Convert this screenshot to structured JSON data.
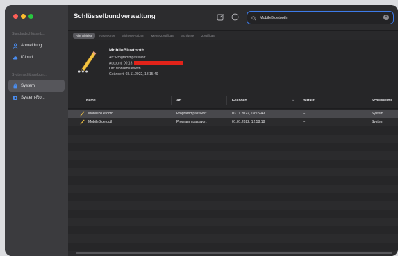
{
  "window": {
    "title": "Schlüsselbundverwaltung"
  },
  "sidebar": {
    "section_default": "Standardschlüsselb...",
    "default_items": [
      {
        "label": "Anmeldung",
        "icon": "person-icon"
      },
      {
        "label": "iCloud",
        "icon": "cloud-icon"
      }
    ],
    "section_system": "Systemschlüsselbun...",
    "system_items": [
      {
        "label": "System",
        "icon": "lock-icon",
        "selected": true
      },
      {
        "label": "System-Ro...",
        "icon": "certificate-icon"
      }
    ]
  },
  "toolbar": {
    "compose_icon": "compose-icon",
    "info_icon": "info-icon"
  },
  "search": {
    "value": "MobileBluetooth",
    "placeholder": "Suchen"
  },
  "filters": [
    {
      "label": "Alle Objekte",
      "active": true
    },
    {
      "label": "Passwörter"
    },
    {
      "label": "Sichere Notizen"
    },
    {
      "label": "Meine Zertifikate"
    },
    {
      "label": "Schlüssel"
    },
    {
      "label": "Zertifikate"
    }
  ],
  "detail": {
    "name": "MobileBluetooth",
    "kind": "Art: Programmpasswort",
    "account_prefix": "Account: 00:18:",
    "location": "Ort: MobileBluetooth",
    "modified": "Geändert: 03.11.2022, 18:15:49"
  },
  "table": {
    "columns": [
      "Name",
      "Art",
      "Geändert",
      "Verfällt",
      "Schlüsselbu..."
    ],
    "sort_indicator": "⌄",
    "rows": [
      {
        "name": "MobileBluetooth",
        "kind": "Programmpasswort",
        "modified": "03.11.2022, 18:15:49",
        "expires": "--",
        "keychain": "System"
      },
      {
        "name": "MobileBluetooth",
        "kind": "Programmpasswort",
        "modified": "01.01.2022, 12:58:18",
        "expires": "--",
        "keychain": "System"
      }
    ]
  },
  "colors": {
    "accent": "#3d7be9",
    "redaction": "#e2231a",
    "sidebar_bg": "#3b3b3e",
    "content_bg": "#232325"
  }
}
